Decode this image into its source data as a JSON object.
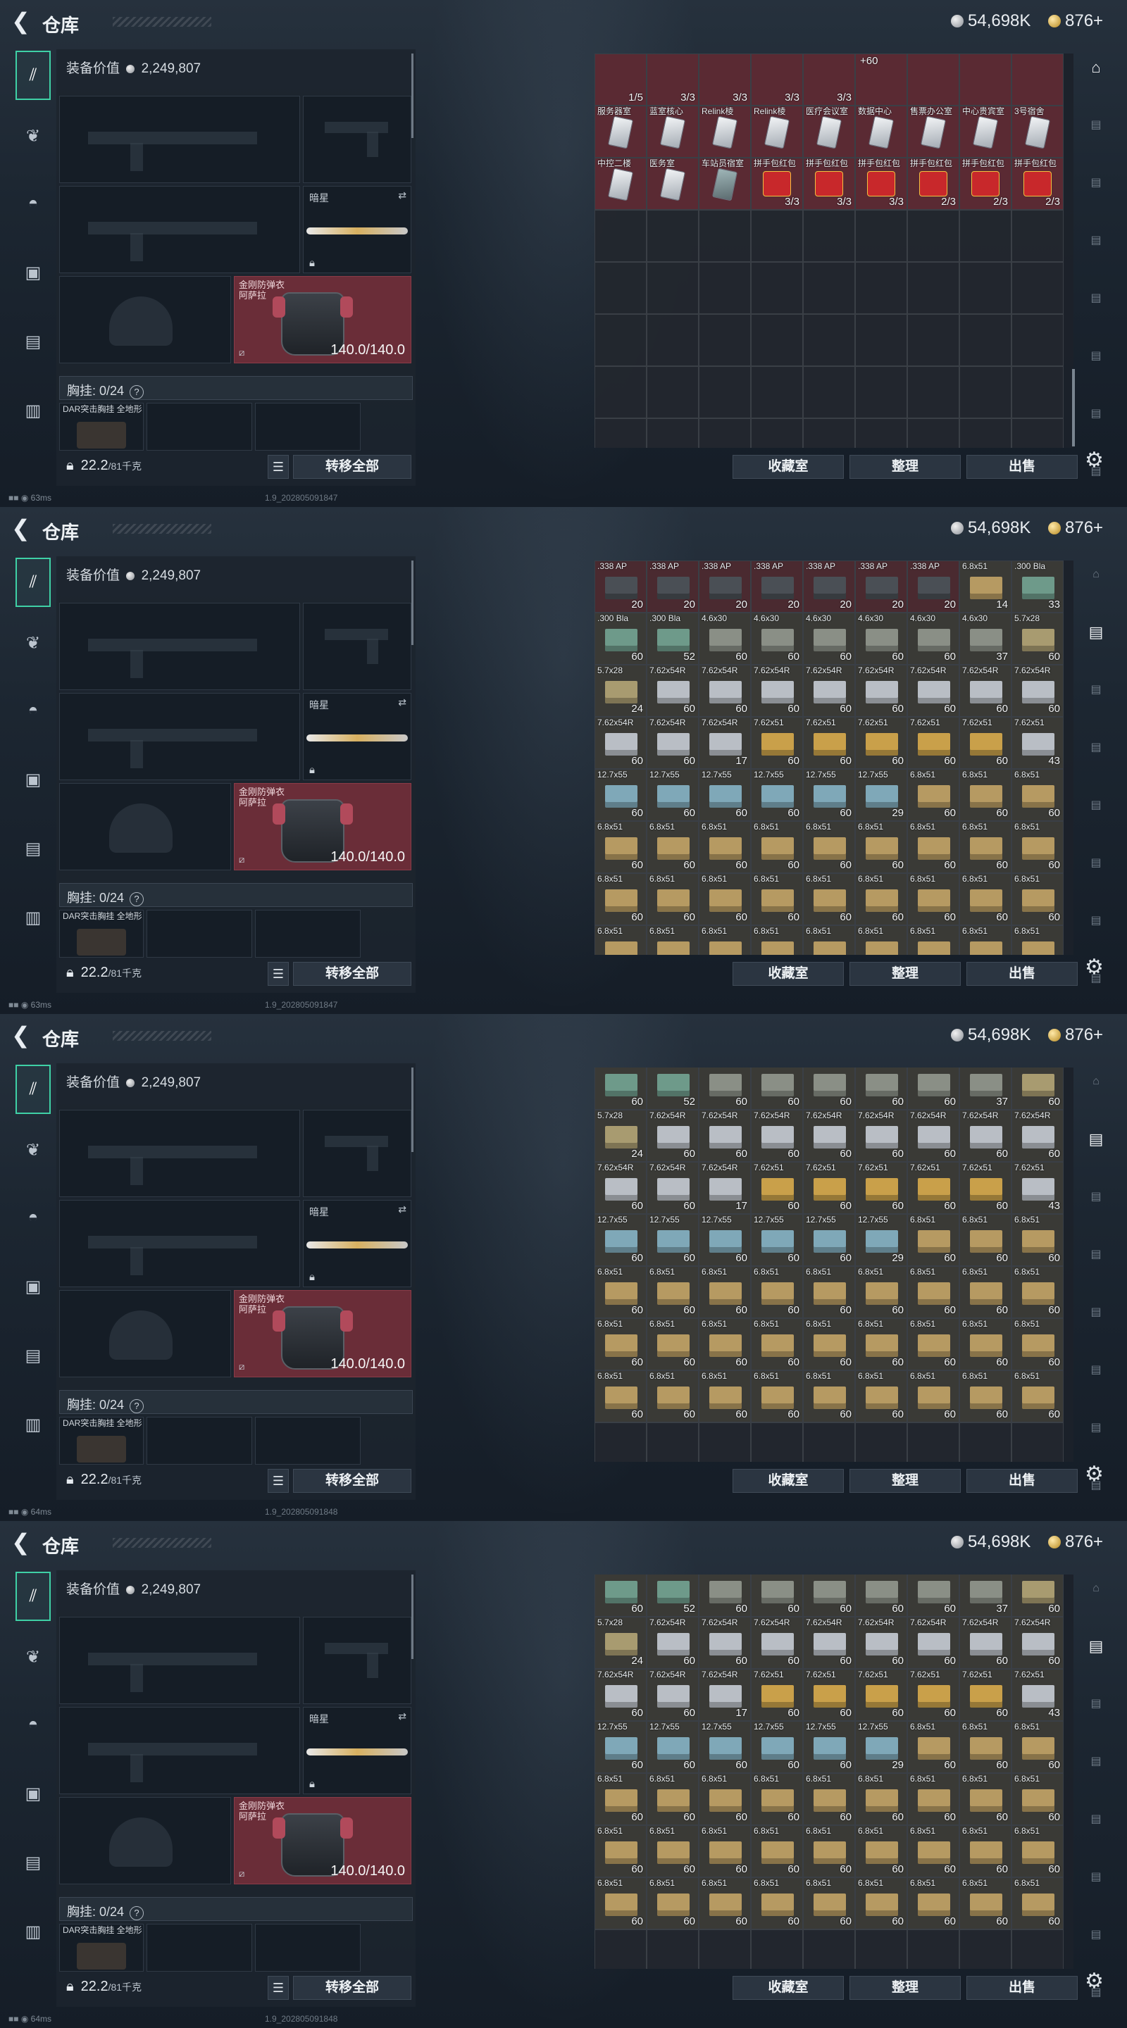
{
  "header": {
    "title": "仓库",
    "silver": "54,698K",
    "gold": "876+"
  },
  "left": {
    "equip_value_label": "装备价值",
    "equip_value": "2,249,807",
    "knife_name": "暗星",
    "armor_name": "金刚防弹衣",
    "armor_sub": "阿萨拉",
    "armor_durability": "140.0/140.0",
    "chest_label": "胸挂: 0/24",
    "help_mark": "?",
    "rig_name": "DAR突击胸挂 全地形",
    "weight": "22.2",
    "weight_unit": "/81千克",
    "transfer_label": "转移全部"
  },
  "buttons": {
    "collection": "收藏室",
    "sort": "整理",
    "sell": "出售"
  },
  "frames": [
    {
      "status": "63ms",
      "build": "1.9_202805091847"
    },
    {
      "status": "63ms",
      "build": "1.9_202805091847"
    },
    {
      "status": "64ms",
      "build": "1.9_202805091848"
    },
    {
      "status": "64ms",
      "build": "1.9_202805091848"
    }
  ],
  "grid1": [
    [
      [
        "",
        "1/5",
        "b"
      ],
      [
        "",
        "3/3",
        "b"
      ],
      [
        "",
        "3/3",
        "b"
      ],
      [
        "",
        "3/3",
        "b"
      ],
      [
        "",
        "3/3",
        "b"
      ],
      [
        "",
        "+60",
        "b"
      ],
      [
        "",
        "",
        "b"
      ],
      [
        "",
        "",
        "b"
      ],
      [
        "",
        "",
        "b"
      ]
    ],
    [
      [
        "服务器室",
        "",
        "c"
      ],
      [
        "蓝室核心",
        "",
        "c"
      ],
      [
        "Relink棱",
        "",
        "c"
      ],
      [
        "Relink棱",
        "",
        "c"
      ],
      [
        "医疗会议室",
        "",
        "c"
      ],
      [
        "数据中心",
        "",
        "c"
      ],
      [
        "售票办公室",
        "",
        "c"
      ],
      [
        "中心贵宾室",
        "",
        "c"
      ],
      [
        "3号宿舍",
        "",
        "c"
      ]
    ],
    [
      [
        "中控二楼",
        "",
        "c"
      ],
      [
        "医务室",
        "",
        "c"
      ],
      [
        "车站员宿室",
        "",
        "d"
      ],
      [
        "拼手包红包",
        "3/3",
        "e"
      ],
      [
        "拼手包红包",
        "3/3",
        "e"
      ],
      [
        "拼手包红包",
        "3/3",
        "e"
      ],
      [
        "拼手包红包",
        "2/3",
        "e"
      ],
      [
        "拼手包红包",
        "2/3",
        "e"
      ],
      [
        "拼手包红包",
        "2/3",
        "e"
      ]
    ]
  ],
  "grid2": [
    [
      [
        ".338 AP",
        "20",
        "k"
      ],
      [
        ".338 AP",
        "20",
        "k"
      ],
      [
        ".338 AP",
        "20",
        "k"
      ],
      [
        ".338 AP",
        "20",
        "k"
      ],
      [
        ".338 AP",
        "20",
        "k"
      ],
      [
        ".338 AP",
        "20",
        "k"
      ],
      [
        ".338 AP",
        "20",
        "k"
      ],
      [
        "6.8x51",
        "14",
        "h"
      ],
      [
        ".300 Bla",
        "33",
        "g"
      ]
    ],
    [
      [
        ".300 Bla",
        "60",
        "g"
      ],
      [
        ".300 Bla",
        "52",
        "g"
      ],
      [
        "4.6x30",
        "60",
        "t"
      ],
      [
        "4.6x30",
        "60",
        "t"
      ],
      [
        "4.6x30",
        "60",
        "t"
      ],
      [
        "4.6x30",
        "60",
        "t"
      ],
      [
        "4.6x30",
        "60",
        "t"
      ],
      [
        "4.6x30",
        "37",
        "t"
      ],
      [
        "5.7x28",
        "60",
        "s"
      ]
    ],
    [
      [
        "5.7x28",
        "24",
        "s"
      ],
      [
        "7.62x54R",
        "60",
        "w"
      ],
      [
        "7.62x54R",
        "60",
        "w"
      ],
      [
        "7.62x54R",
        "60",
        "w"
      ],
      [
        "7.62x54R",
        "60",
        "w"
      ],
      [
        "7.62x54R",
        "60",
        "w"
      ],
      [
        "7.62x54R",
        "60",
        "w"
      ],
      [
        "7.62x54R",
        "60",
        "w"
      ],
      [
        "7.62x54R",
        "60",
        "w"
      ]
    ],
    [
      [
        "7.62x54R",
        "60",
        "w"
      ],
      [
        "7.62x54R",
        "60",
        "w"
      ],
      [
        "7.62x54R",
        "17",
        "w"
      ],
      [
        "7.62x51",
        "60",
        "y"
      ],
      [
        "7.62x51",
        "60",
        "y"
      ],
      [
        "7.62x51",
        "60",
        "y"
      ],
      [
        "7.62x51",
        "60",
        "y"
      ],
      [
        "7.62x51",
        "60",
        "y"
      ],
      [
        "7.62x51",
        "43",
        "w"
      ]
    ],
    [
      [
        "12.7x55",
        "60",
        "c2"
      ],
      [
        "12.7x55",
        "60",
        "c2"
      ],
      [
        "12.7x55",
        "60",
        "c2"
      ],
      [
        "12.7x55",
        "60",
        "c2"
      ],
      [
        "12.7x55",
        "60",
        "c2"
      ],
      [
        "12.7x55",
        "29",
        "c2"
      ],
      [
        "6.8x51",
        "60",
        "h"
      ],
      [
        "6.8x51",
        "60",
        "h"
      ],
      [
        "6.8x51",
        "60",
        "h"
      ]
    ],
    [
      [
        "6.8x51",
        "60",
        "h"
      ],
      [
        "6.8x51",
        "60",
        "h"
      ],
      [
        "6.8x51",
        "60",
        "h"
      ],
      [
        "6.8x51",
        "60",
        "h"
      ],
      [
        "6.8x51",
        "60",
        "h"
      ],
      [
        "6.8x51",
        "60",
        "h"
      ],
      [
        "6.8x51",
        "60",
        "h"
      ],
      [
        "6.8x51",
        "60",
        "h"
      ],
      [
        "6.8x51",
        "60",
        "h"
      ]
    ],
    [
      [
        "6.8x51",
        "60",
        "h"
      ],
      [
        "6.8x51",
        "60",
        "h"
      ],
      [
        "6.8x51",
        "60",
        "h"
      ],
      [
        "6.8x51",
        "60",
        "h"
      ],
      [
        "6.8x51",
        "60",
        "h"
      ],
      [
        "6.8x51",
        "60",
        "h"
      ],
      [
        "6.8x51",
        "60",
        "h"
      ],
      [
        "6.8x51",
        "60",
        "h"
      ],
      [
        "6.8x51",
        "60",
        "h"
      ]
    ],
    [
      [
        "6.8x51",
        "",
        "h"
      ],
      [
        "6.8x51",
        "",
        "h"
      ],
      [
        "6.8x51",
        "",
        "h"
      ],
      [
        "6.8x51",
        "",
        "h"
      ],
      [
        "6.8x51",
        "",
        "h"
      ],
      [
        "6.8x51",
        "",
        "h"
      ],
      [
        "6.8x51",
        "",
        "h"
      ],
      [
        "6.8x51",
        "",
        "h"
      ],
      [
        "6.8x51",
        "",
        "h"
      ]
    ]
  ],
  "grid3": [
    [
      [
        "",
        "60",
        "g"
      ],
      [
        "",
        "52",
        "g"
      ],
      [
        "",
        "60",
        "t"
      ],
      [
        "",
        "60",
        "t"
      ],
      [
        "",
        "60",
        "t"
      ],
      [
        "",
        "60",
        "t"
      ],
      [
        "",
        "60",
        "t"
      ],
      [
        "",
        "37",
        "t"
      ],
      [
        "",
        "60",
        "s"
      ]
    ],
    [
      [
        "5.7x28",
        "24",
        "s"
      ],
      [
        "7.62x54R",
        "60",
        "w"
      ],
      [
        "7.62x54R",
        "60",
        "w"
      ],
      [
        "7.62x54R",
        "60",
        "w"
      ],
      [
        "7.62x54R",
        "60",
        "w"
      ],
      [
        "7.62x54R",
        "60",
        "w"
      ],
      [
        "7.62x54R",
        "60",
        "w"
      ],
      [
        "7.62x54R",
        "60",
        "w"
      ],
      [
        "7.62x54R",
        "60",
        "w"
      ]
    ],
    [
      [
        "7.62x54R",
        "60",
        "w"
      ],
      [
        "7.62x54R",
        "60",
        "w"
      ],
      [
        "7.62x54R",
        "17",
        "w"
      ],
      [
        "7.62x51",
        "60",
        "y"
      ],
      [
        "7.62x51",
        "60",
        "y"
      ],
      [
        "7.62x51",
        "60",
        "y"
      ],
      [
        "7.62x51",
        "60",
        "y"
      ],
      [
        "7.62x51",
        "60",
        "y"
      ],
      [
        "7.62x51",
        "43",
        "w"
      ]
    ],
    [
      [
        "12.7x55",
        "60",
        "c2"
      ],
      [
        "12.7x55",
        "60",
        "c2"
      ],
      [
        "12.7x55",
        "60",
        "c2"
      ],
      [
        "12.7x55",
        "60",
        "c2"
      ],
      [
        "12.7x55",
        "60",
        "c2"
      ],
      [
        "12.7x55",
        "29",
        "c2"
      ],
      [
        "6.8x51",
        "60",
        "h"
      ],
      [
        "6.8x51",
        "60",
        "h"
      ],
      [
        "6.8x51",
        "60",
        "h"
      ]
    ],
    [
      [
        "6.8x51",
        "60",
        "h"
      ],
      [
        "6.8x51",
        "60",
        "h"
      ],
      [
        "6.8x51",
        "60",
        "h"
      ],
      [
        "6.8x51",
        "60",
        "h"
      ],
      [
        "6.8x51",
        "60",
        "h"
      ],
      [
        "6.8x51",
        "60",
        "h"
      ],
      [
        "6.8x51",
        "60",
        "h"
      ],
      [
        "6.8x51",
        "60",
        "h"
      ],
      [
        "6.8x51",
        "60",
        "h"
      ]
    ],
    [
      [
        "6.8x51",
        "60",
        "h"
      ],
      [
        "6.8x51",
        "60",
        "h"
      ],
      [
        "6.8x51",
        "60",
        "h"
      ],
      [
        "6.8x51",
        "60",
        "h"
      ],
      [
        "6.8x51",
        "60",
        "h"
      ],
      [
        "6.8x51",
        "60",
        "h"
      ],
      [
        "6.8x51",
        "60",
        "h"
      ],
      [
        "6.8x51",
        "60",
        "h"
      ],
      [
        "6.8x51",
        "60",
        "h"
      ]
    ],
    [
      [
        "6.8x51",
        "60",
        "h"
      ],
      [
        "6.8x51",
        "60",
        "h"
      ],
      [
        "6.8x51",
        "60",
        "h"
      ],
      [
        "6.8x51",
        "60",
        "h"
      ],
      [
        "6.8x51",
        "60",
        "h"
      ],
      [
        "6.8x51",
        "60",
        "h"
      ],
      [
        "6.8x51",
        "60",
        "h"
      ],
      [
        "6.8x51",
        "60",
        "h"
      ],
      [
        "6.8x51",
        "60",
        "h"
      ]
    ]
  ],
  "colors": {
    "accent": "#3fd1a6",
    "armor_bg": "#6a2d38",
    "box_w": "#b9bec5",
    "box_y": "#c9a04a",
    "box_h": "#b69a62",
    "box_c2": "#7fa8b8",
    "box_g": "#6e9a8a",
    "box_t": "#8a8f86",
    "box_s": "#a89b70",
    "box_k": "#4a4f55",
    "card": "#e3e6ea",
    "envelope": "#c8282b",
    "red_cell": "#5a2a33"
  },
  "icons": {
    "back": "back-arrow-icon",
    "nav": [
      "gun-icon",
      "armor-icon",
      "helmet-icon",
      "backpack-icon",
      "container-icon",
      "briefcase-icon"
    ],
    "side": [
      "storage-icon",
      "case-icon",
      "case-icon",
      "case-icon",
      "case-icon",
      "case-icon",
      "case-icon",
      "case-icon"
    ],
    "gear": "gear-icon"
  }
}
